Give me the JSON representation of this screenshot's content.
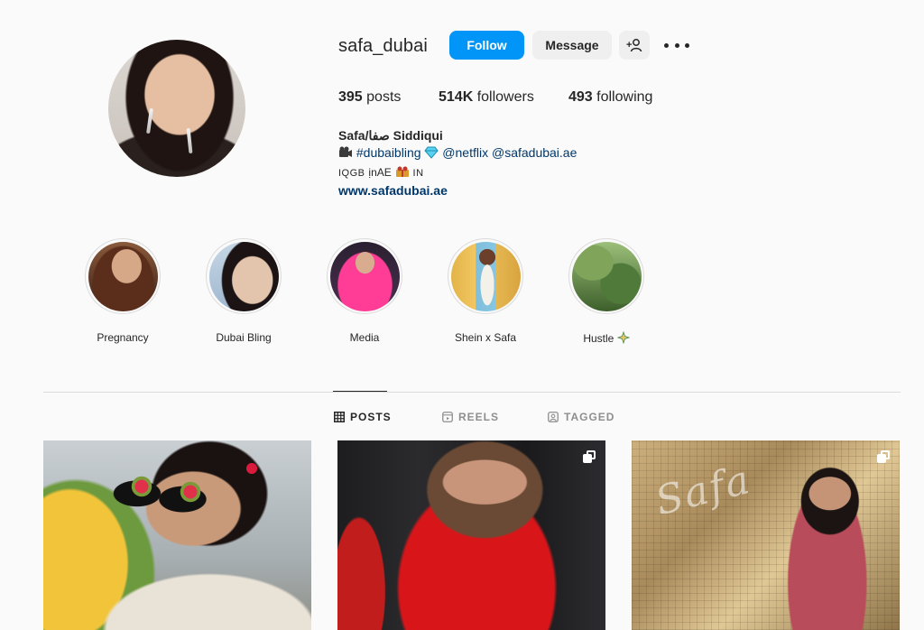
{
  "profile": {
    "username": "safa_dubai",
    "follow_label": "Follow",
    "message_label": "Message",
    "add_user_label": "+",
    "stats": {
      "posts_count": "395",
      "posts_label": "posts",
      "followers_count": "514K",
      "followers_label": "followers",
      "following_count": "493",
      "following_label": "following"
    },
    "bio": {
      "name": "Safa/صفا Siddiqui",
      "line1_hashtag": "#dubaibling",
      "line1_mention1": "@netflix",
      "line1_mention2": "@safadubai.ae",
      "line2_text1": "IQGB",
      "line2_text2": "ịnAE",
      "line2_text3": "IN",
      "website": "www.safadubai.ae"
    }
  },
  "highlights": [
    {
      "label": "Pregnancy"
    },
    {
      "label": "Dubai Bling"
    },
    {
      "label": "Media"
    },
    {
      "label": "Shein x Safa"
    },
    {
      "label": "Hustle"
    }
  ],
  "tabs": {
    "posts": "POSTS",
    "reels": "REELS",
    "tagged": "TAGGED",
    "active": "posts"
  },
  "posts": [
    {
      "multi": false
    },
    {
      "multi": true
    },
    {
      "multi": true
    }
  ],
  "post3_neon_text": "Safa",
  "colors": {
    "accent": "#0095f6",
    "link": "#00376b",
    "background": "#fafafa",
    "secondary_button": "#efefef"
  },
  "icons": [
    "more-options-icon",
    "add-user-icon",
    "camera-icon",
    "diamond-icon",
    "gift-icon",
    "sparkle-icon",
    "grid-icon",
    "reels-icon",
    "tagged-icon",
    "multiple-posts-icon"
  ]
}
